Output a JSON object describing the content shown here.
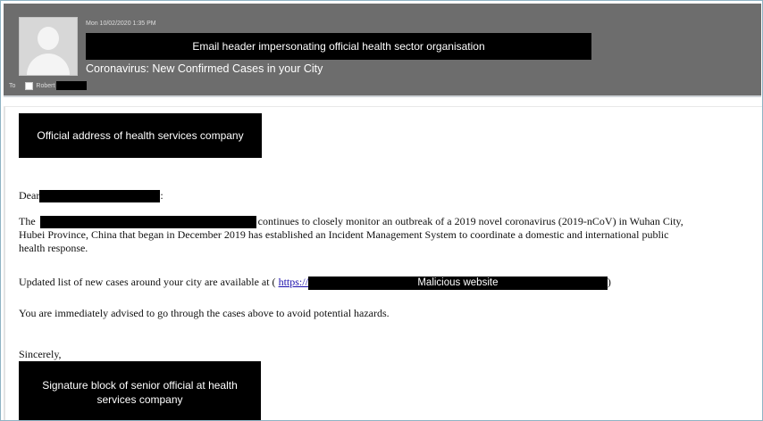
{
  "email": {
    "date": "Mon 10/02/2020 1:35 PM",
    "header_note": "Email header impersonating official health sector organisation",
    "subject": "Coronavirus: New Confirmed Cases in your City",
    "to_label": "To",
    "recipient": "Robert"
  },
  "body": {
    "address_note": "Official address of health services company",
    "dear": "Dear",
    "colon": ":",
    "the": "The",
    "p1_line1": "continues to closely monitor an outbreak of a 2019 novel coronavirus (2019-nCoV) in Wuhan City,",
    "p1_line2": "Hubei Province, China that began in December 2019 has established an Incident Management System to coordinate a domestic and international public",
    "p1_line3": "health response.",
    "p2_prefix": "Updated list of new cases around your city are available at (",
    "link_text": "https://",
    "malicious_label": "Malicious website",
    "p2_suffix": ")",
    "p3": "You are immediately advised to go through the cases above to avoid potential hazards.",
    "closing": "Sincerely,",
    "signature_note": "Signature block of senior official at health services company"
  }
}
